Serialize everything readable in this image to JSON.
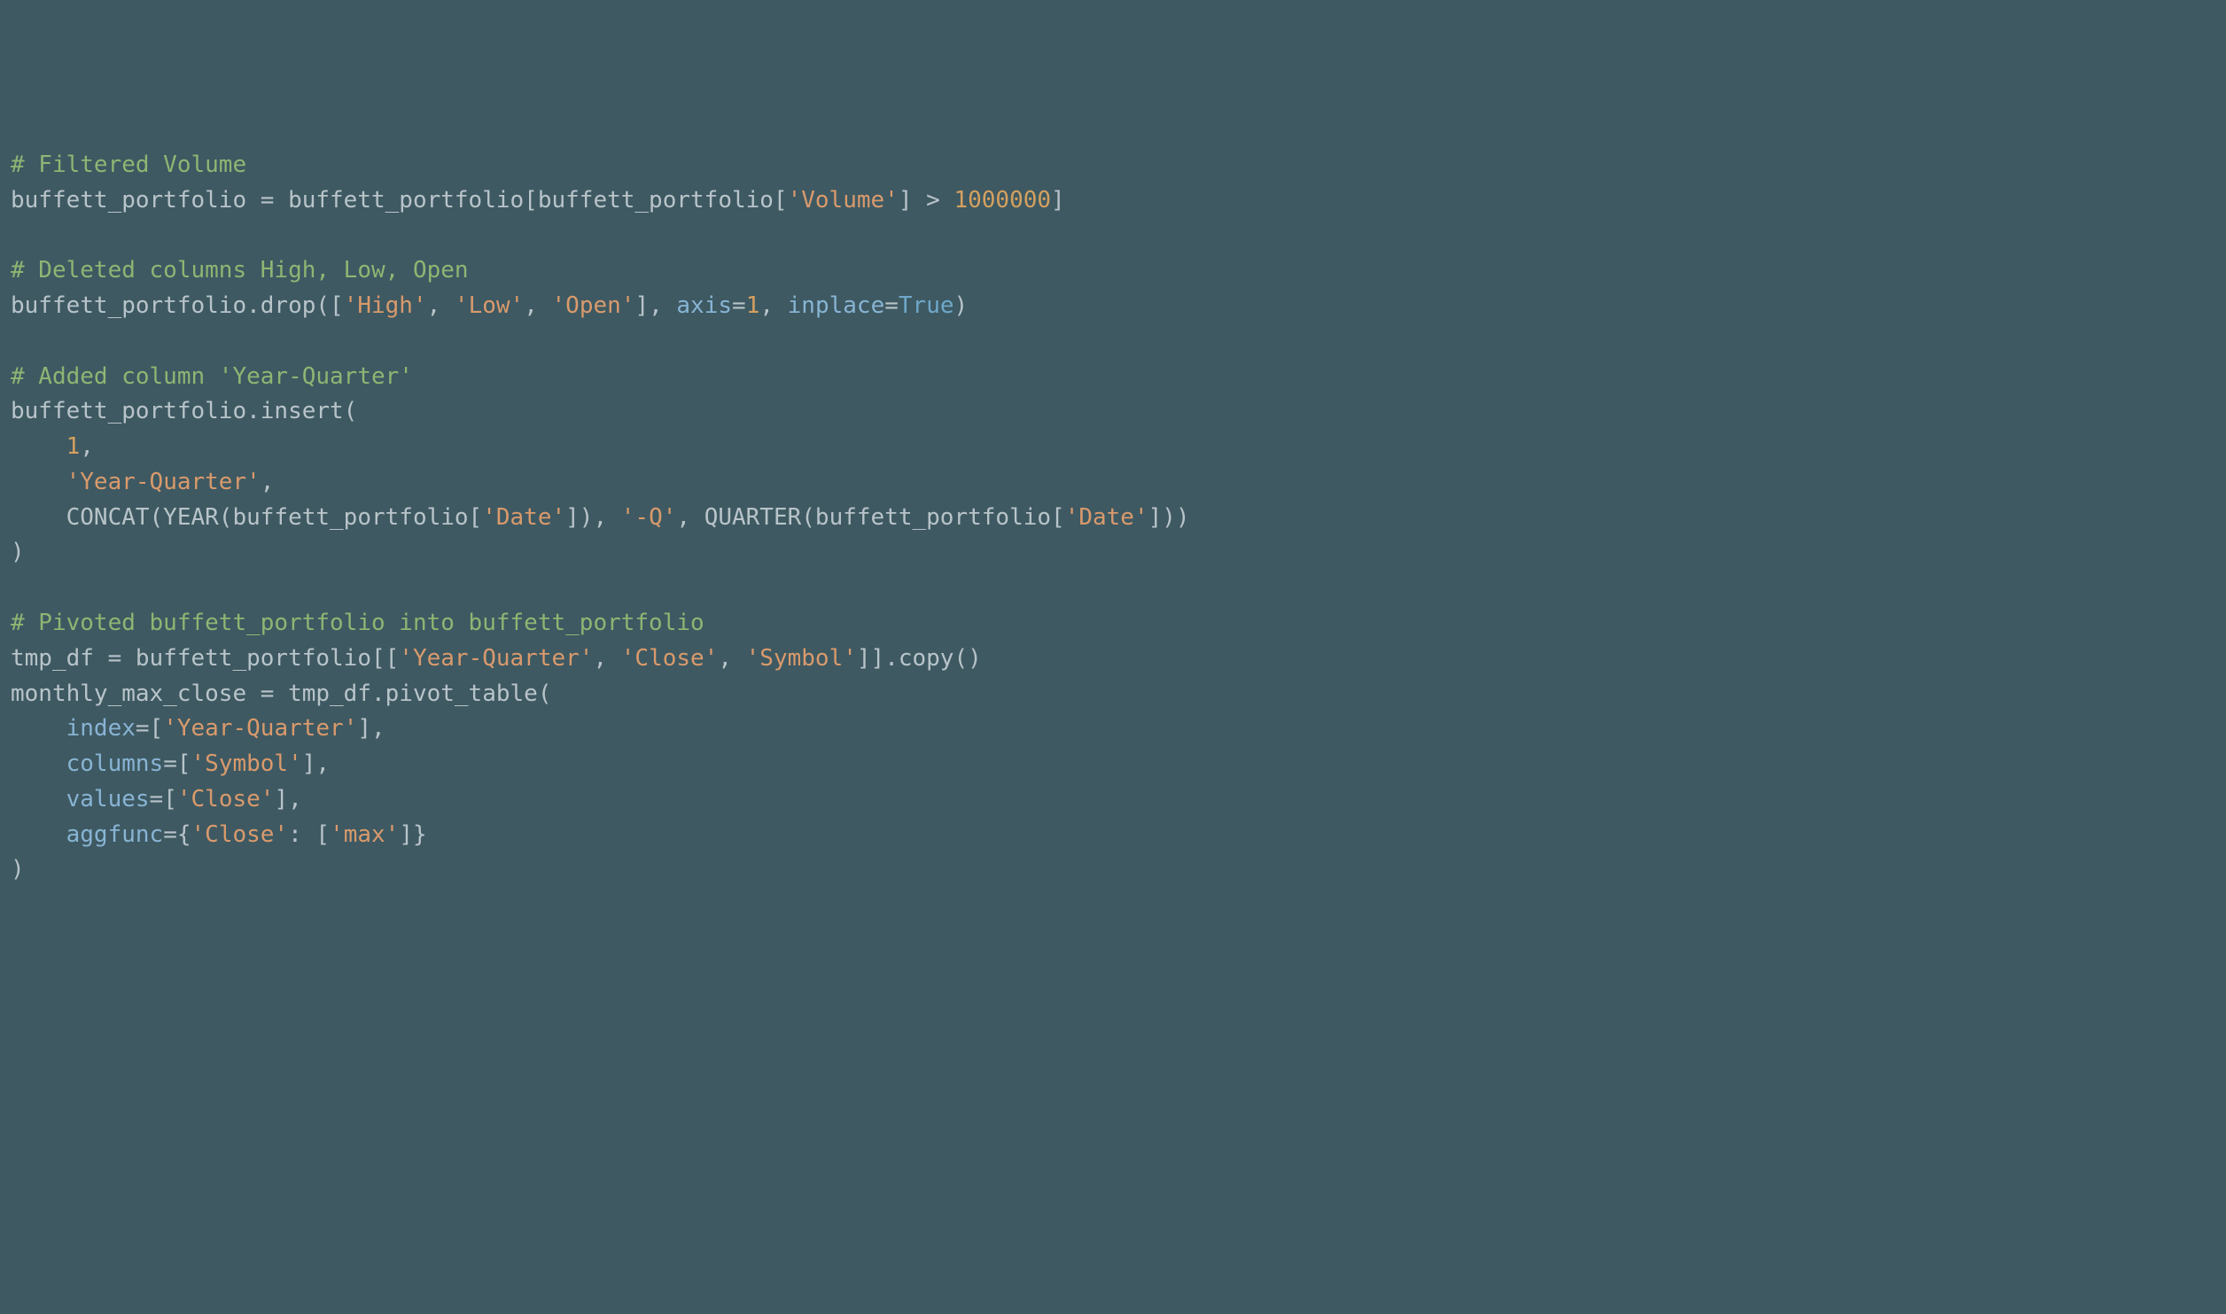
{
  "code": {
    "line1_comment": "# Filtered Volume",
    "line2_a": "buffett_portfolio = buffett_portfolio[buffett_portfolio[",
    "line2_str1": "'Volume'",
    "line2_b": "] > ",
    "line2_num": "1000000",
    "line2_c": "]",
    "line4_comment": "# Deleted columns High, Low, Open",
    "line5_a": "buffett_portfolio.drop([",
    "line5_str1": "'High'",
    "line5_b": ", ",
    "line5_str2": "'Low'",
    "line5_c": ", ",
    "line5_str3": "'Open'",
    "line5_d": "], ",
    "line5_param1": "axis",
    "line5_e": "=",
    "line5_num1": "1",
    "line5_f": ", ",
    "line5_param2": "inplace",
    "line5_g": "=",
    "line5_true": "True",
    "line5_h": ")",
    "line7_comment": "# Added column 'Year-Quarter'",
    "line8_a": "buffett_portfolio.insert(",
    "line9_a": "    ",
    "line9_num": "1",
    "line9_b": ",",
    "line10_a": "    ",
    "line10_str": "'Year-Quarter'",
    "line10_b": ",",
    "line11_a": "    CONCAT(YEAR(buffett_portfolio[",
    "line11_str1": "'Date'",
    "line11_b": "]), ",
    "line11_str2": "'-Q'",
    "line11_c": ", QUARTER(buffett_portfolio[",
    "line11_str3": "'Date'",
    "line11_d": "]))",
    "line12_a": ")",
    "line14_comment": "# Pivoted buffett_portfolio into buffett_portfolio",
    "line15_a": "tmp_df = buffett_portfolio[[",
    "line15_str1": "'Year-Quarter'",
    "line15_b": ", ",
    "line15_str2": "'Close'",
    "line15_c": ", ",
    "line15_str3": "'Symbol'",
    "line15_d": "]].copy()",
    "line16_a": "monthly_max_close = tmp_df.pivot_table(",
    "line17_a": "    ",
    "line17_param": "index",
    "line17_b": "=[",
    "line17_str": "'Year-Quarter'",
    "line17_c": "],",
    "line18_a": "    ",
    "line18_param": "columns",
    "line18_b": "=[",
    "line18_str": "'Symbol'",
    "line18_c": "],",
    "line19_a": "    ",
    "line19_param": "values",
    "line19_b": "=[",
    "line19_str": "'Close'",
    "line19_c": "],",
    "line20_a": "    ",
    "line20_param": "aggfunc",
    "line20_b": "={",
    "line20_str1": "'Close'",
    "line20_c": ": [",
    "line20_str2": "'max'",
    "line20_d": "]}",
    "line21_a": ")"
  }
}
